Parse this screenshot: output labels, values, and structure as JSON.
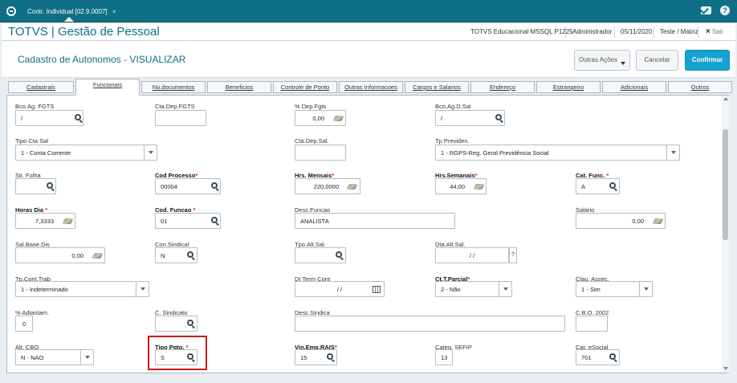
{
  "window": {
    "tab_title": "Contr. Individual [02.9.0007]",
    "tab_close": "×"
  },
  "app": {
    "title": "TOTVS | Gestão de Pessoal",
    "environment": "TOTVS Educacional MSSQL P1225",
    "user": "Administrador",
    "date": "05/11/2020",
    "company": "Teste / Matriz",
    "exit_icon": "×",
    "exit_label": "Sair"
  },
  "page": {
    "title": "Cadastro de Autonomos - VISUALIZAR",
    "outras_acoes": "Outras Ações",
    "cancelar": "Cancelar",
    "confirmar": "Confirmar"
  },
  "tabs": [
    "Cadastrais",
    "Funcionais",
    "No.documentos",
    "Beneficios",
    "Controle de Ponto",
    "Outras Informacoes",
    "Cargos e Salarios",
    "Endereço",
    "Estrangeiro",
    "Adicionais",
    "Outros"
  ],
  "form": {
    "bco_ag_fgts": {
      "label": "Bco.Ag. FGTS",
      "value": "/"
    },
    "cta_dep_fgts": {
      "label": "Cta.Dep.FGTS",
      "value": ""
    },
    "pct_dep_fgts": {
      "label": "% Dep.Fgts",
      "value": "0,00"
    },
    "bco_ag_d_sal": {
      "label": "Bco.Ag.D.Sal",
      "value": "/"
    },
    "tipo_cta_sal": {
      "label": "Tipo Cta Sal",
      "value": "1 - Conta Corrente"
    },
    "cta_dep_sal": {
      "label": "Cta.Dep.Sal.",
      "value": ""
    },
    "tp_previden": {
      "label": "Tp Previden.",
      "value": "1 - RGPS-Reg. Geral Previdência Social"
    },
    "sit_folha": {
      "label": "Sit. Folha",
      "value": ""
    },
    "cod_processo": {
      "label": "Cod Processo",
      "req": "*",
      "value": "00004"
    },
    "hrs_mensais": {
      "label": "Hrs. Mensais",
      "req": "*",
      "value": "220,0000"
    },
    "hrs_semanais": {
      "label": "Hrs.Semanais",
      "req": "*",
      "value": "44,00"
    },
    "cat_func": {
      "label": "Cat. Func.",
      "req": "*",
      "value": "A"
    },
    "horas_dia": {
      "label": "Horas Dia",
      "req": "*",
      "value": "7,3333"
    },
    "cod_funcao": {
      "label": "Cod. Funcao",
      "req": "*",
      "value": "01"
    },
    "desc_funcao": {
      "label": "Desc.Funcao",
      "value": "ANALISTA"
    },
    "salario": {
      "label": "Salário",
      "value": "0,00"
    },
    "sal_base_dis": {
      "label": "Sal.Base.Dis",
      "value": "0,00"
    },
    "con_sindical": {
      "label": "Con.Sindical",
      "value": "N"
    },
    "tpo_alt_sal": {
      "label": "Tpo.Alt.Sal.",
      "value": ""
    },
    "dta_alt_sal": {
      "label": "Dta.Alt.Sal.",
      "value": "/ /",
      "q": "?"
    },
    "tp_cont_trab": {
      "label": "Tp.Cont.Trab",
      "value": "1 - Indeterminado"
    },
    "dt_term_cont": {
      "label": "Dt Term Cont",
      "value": "/ /"
    },
    "ct_t_parcial": {
      "label": "Ct.T.Parcial",
      "req": "*",
      "value": "2 - Não"
    },
    "clau_assec": {
      "label": "Clau. Assec.",
      "value": "1 - Sim"
    },
    "pct_adiantam": {
      "label": "% Adiantam.",
      "value": "0"
    },
    "c_sindicato": {
      "label": "C. Sindicato",
      "value": ""
    },
    "desc_sindica": {
      "label": "Desc.Sindica",
      "value": ""
    },
    "cbo_2002": {
      "label": "C.B.O. 2002",
      "value": ""
    },
    "alt_cbo": {
      "label": "Alt. CBO",
      "value": "N - NAO"
    },
    "tipo_pgto": {
      "label": "Tipo Pgto.",
      "req": "*",
      "value": "S"
    },
    "vin_emp_rais": {
      "label": "Vin.Emp.RAIS",
      "req": "*",
      "value": "15"
    },
    "categ_sefip": {
      "label": "Categ. SEFIP",
      "value": "13"
    },
    "cat_esocial": {
      "label": "Cat. eSocial",
      "value": "701"
    }
  },
  "icons": {
    "lookup": "magnifier-icon",
    "clear": "eraser-icon",
    "calendar": "calendar-icon",
    "dropdown": "chevron-down-icon"
  },
  "colors": {
    "brand": "#0f6f86",
    "primary_button": "#17a3cf",
    "required": "#d9231f",
    "highlight": "#d01818"
  }
}
